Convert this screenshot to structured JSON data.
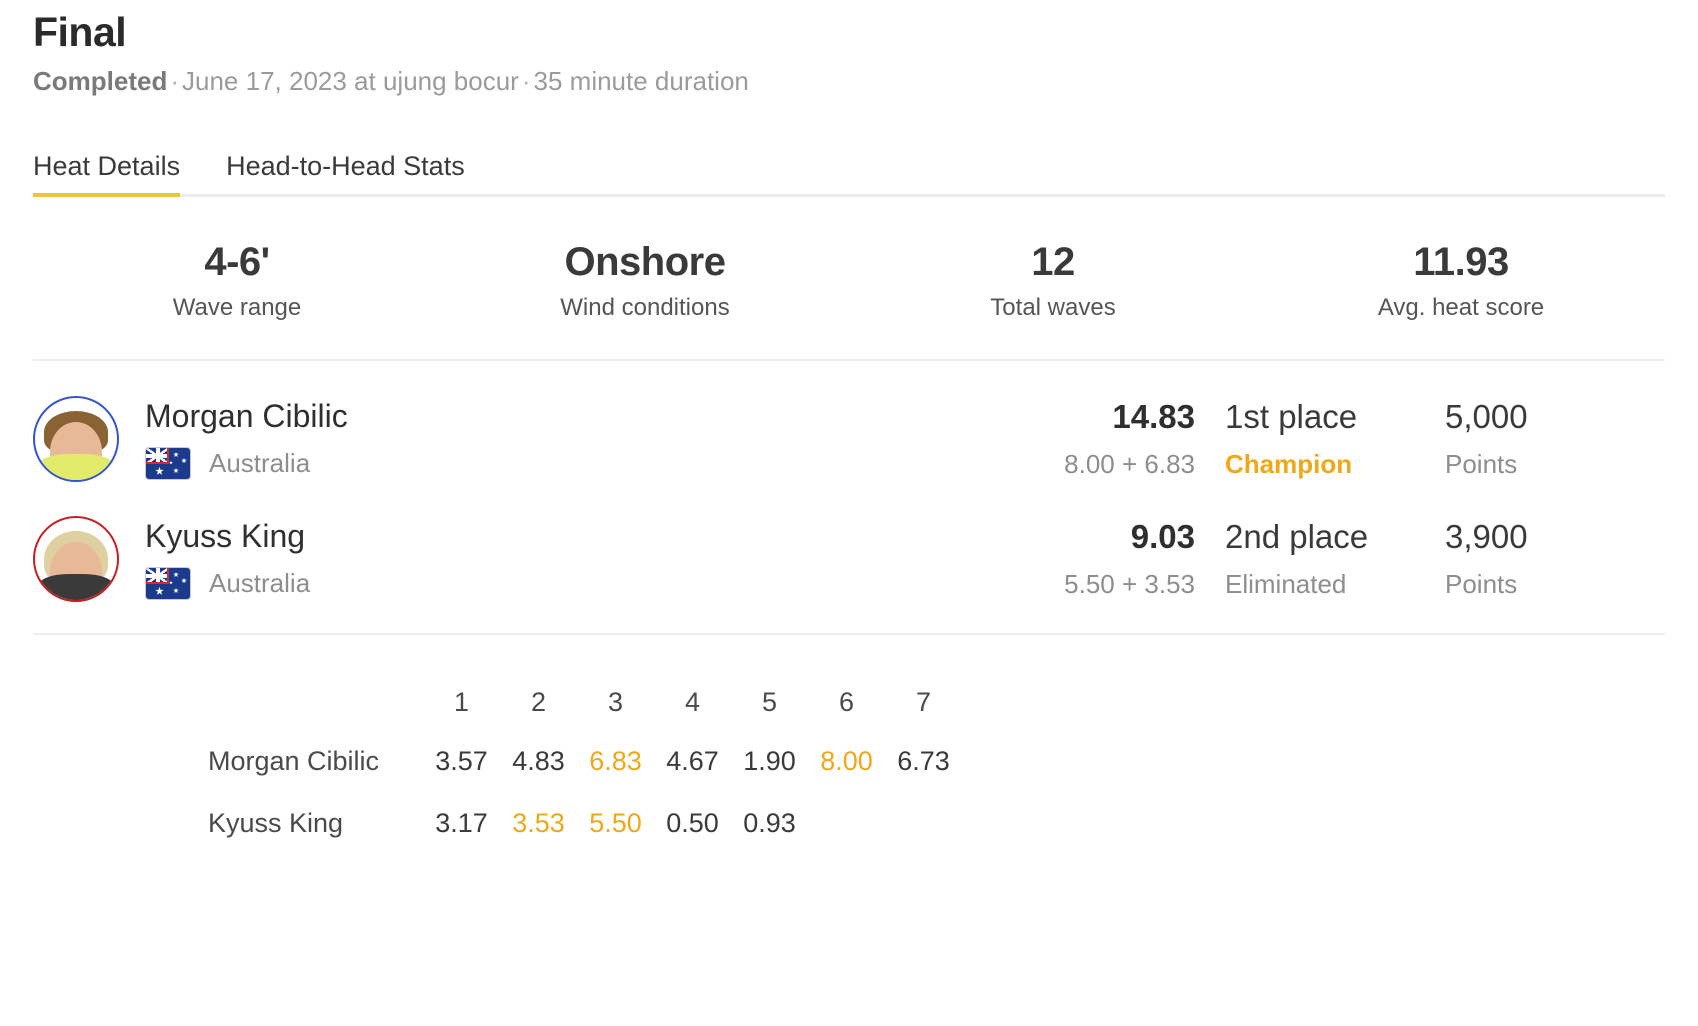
{
  "header": {
    "title": "Final",
    "status": "Completed",
    "separator": "·",
    "date_location": "June 17, 2023 at ujung bocur",
    "duration": "35 minute duration"
  },
  "tabs": [
    {
      "label": "Heat Details",
      "active": true
    },
    {
      "label": "Head-to-Head Stats",
      "active": false
    }
  ],
  "stats": [
    {
      "value": "4-6'",
      "label": "Wave range"
    },
    {
      "value": "Onshore",
      "label": "Wind conditions"
    },
    {
      "value": "12",
      "label": "Total waves"
    },
    {
      "value": "11.93",
      "label": "Avg. heat score"
    }
  ],
  "athletes": [
    {
      "name": "Morgan Cibilic",
      "country": "Australia",
      "flag_icon": "australia-flag-icon",
      "ring_color": "#3355cc",
      "total_score": "14.83",
      "score_breakdown": "8.00 + 6.83",
      "place": "1st place",
      "result": "Champion",
      "result_highlight": true,
      "points": "5,000",
      "points_label": "Points"
    },
    {
      "name": "Kyuss King",
      "country": "Australia",
      "flag_icon": "australia-flag-icon",
      "ring_color": "#c42020",
      "total_score": "9.03",
      "score_breakdown": "5.50 + 3.53",
      "place": "2nd place",
      "result": "Eliminated",
      "result_highlight": false,
      "points": "3,900",
      "points_label": "Points"
    }
  ],
  "wave_table": {
    "columns": [
      "1",
      "2",
      "3",
      "4",
      "5",
      "6",
      "7"
    ],
    "rows": [
      {
        "name": "Morgan Cibilic",
        "scores": [
          "3.57",
          "4.83",
          "6.83",
          "4.67",
          "1.90",
          "8.00",
          "6.73"
        ],
        "counted": [
          false,
          false,
          true,
          false,
          false,
          true,
          false
        ]
      },
      {
        "name": "Kyuss King",
        "scores": [
          "3.17",
          "3.53",
          "5.50",
          "0.50",
          "0.93",
          "",
          ""
        ],
        "counted": [
          false,
          true,
          true,
          false,
          false,
          false,
          false
        ]
      }
    ]
  },
  "colors": {
    "accent": "#f0a818",
    "tab_indicator": "#f0c330",
    "text_primary": "#2f2f2f",
    "text_muted": "#8e8e8e",
    "divider": "#ededed"
  }
}
